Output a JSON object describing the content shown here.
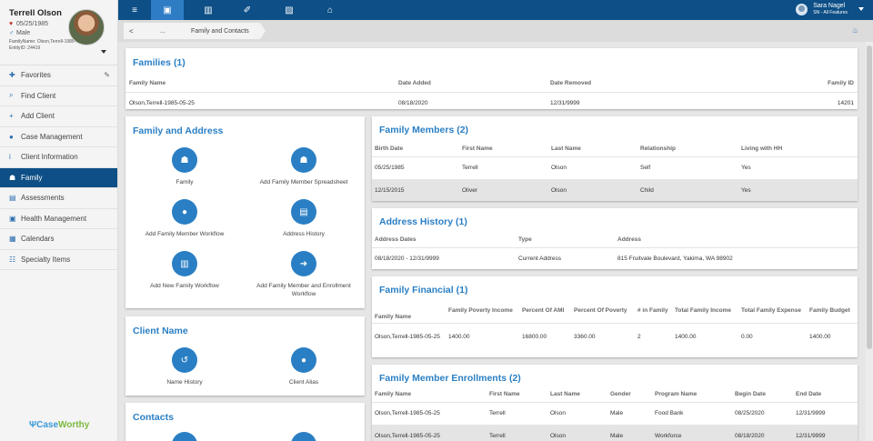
{
  "profile": {
    "name": "Terrell Olson",
    "dob": "05/25/1985",
    "gender": "Male",
    "family_name_line": "FamilyName: Olson,Terrell-1985-05-25",
    "entity_line": "EntityID: 24419"
  },
  "nav": [
    {
      "label": "Favorites",
      "icon": "pin-icon"
    },
    {
      "label": "Find Client",
      "icon": "search-icon"
    },
    {
      "label": "Add Client",
      "icon": "plus-icon"
    },
    {
      "label": "Case Management",
      "icon": "user-icon"
    },
    {
      "label": "Client Information",
      "icon": "info-icon"
    },
    {
      "label": "Family",
      "icon": "family-icon"
    },
    {
      "label": "Assessments",
      "icon": "copy-icon"
    },
    {
      "label": "Health Management",
      "icon": "medkit-icon"
    },
    {
      "label": "Calendars",
      "icon": "calendar-icon"
    },
    {
      "label": "Specialty Items",
      "icon": "users-icon"
    }
  ],
  "logo": {
    "part1": "Case",
    "part2": "Worthy"
  },
  "user": {
    "name": "Sara Nagel",
    "role": "SN - All Features"
  },
  "breadcrumbs": {
    "back": "<",
    "c1": "...",
    "c2": "Family and Contacts"
  },
  "families": {
    "title": "Families (1)",
    "headers": [
      "Family Name",
      "Date Added",
      "Date Removed",
      "Family ID"
    ],
    "rows": [
      [
        "Olson,Terrell-1985-05-25",
        "08/18/2020",
        "12/31/9999",
        "14201"
      ]
    ]
  },
  "family_address": {
    "title": "Family and Address",
    "actions": [
      {
        "label": "Family",
        "icon": "family-icon"
      },
      {
        "label": "Add Family Member Spreadsheet",
        "icon": "family-icon"
      },
      {
        "label": "Add Family Member Workflow",
        "icon": "user-icon"
      },
      {
        "label": "Address History",
        "icon": "file-icon"
      },
      {
        "label": "Add New Family Workflow",
        "icon": "bank-icon"
      },
      {
        "label": "Add Family Member and Enrollment Workflow",
        "icon": "sign-in-icon"
      }
    ]
  },
  "client_name": {
    "title": "Client Name",
    "actions": [
      {
        "label": "Name History",
        "icon": "history-icon"
      },
      {
        "label": "Client Alias",
        "icon": "circle-icon"
      }
    ]
  },
  "contacts": {
    "title": "Contacts"
  },
  "family_members": {
    "title": "Family Members (2)",
    "headers": [
      "Birth Date",
      "First Name",
      "Last Name",
      "Relationship",
      "Living with HH"
    ],
    "rows": [
      [
        "05/25/1985",
        "Terrell",
        "Olson",
        "Self",
        "Yes"
      ],
      [
        "12/15/2015",
        "Oliver",
        "Olson",
        "Child",
        "Yes"
      ]
    ]
  },
  "address_history": {
    "title": "Address History (1)",
    "headers": [
      "Address Dates",
      "Type",
      "Address"
    ],
    "rows": [
      [
        "08/18/2020 - 12/31/9999",
        "Current Address",
        "815 Fruitvale Boulevard, Yakima, WA 98902"
      ]
    ]
  },
  "family_financial": {
    "title": "Family Financial (1)",
    "headers": [
      "Family Name",
      "Family Poverty Income",
      "Percent Of AMI",
      "Percent Of Poverty",
      "# in Family",
      "Total Family Income",
      "Total Family Expense",
      "Family Budget"
    ],
    "rows": [
      [
        "Olson,Terrell-1985-05-25",
        "1400.00",
        "16800.00",
        "3360.00",
        "2",
        "1400.00",
        "0.00",
        "1400.00"
      ]
    ]
  },
  "enrollments": {
    "title": "Family Member Enrollments (2)",
    "headers": [
      "Family Name",
      "First Name",
      "Last Name",
      "Gender",
      "Program Name",
      "Begin Date",
      "End Date"
    ],
    "rows": [
      [
        "Olson,Terrell-1985-05-25",
        "Terrell",
        "Olson",
        "Male",
        "Food Bank",
        "08/25/2020",
        "12/31/9999"
      ],
      [
        "Olson,Terrell-1985-05-25",
        "Terrell",
        "Olson",
        "Male",
        "Workforce",
        "08/18/2020",
        "12/31/9999"
      ]
    ]
  },
  "colors": {
    "primary": "#0d4f86",
    "accent": "#2a7fc4"
  }
}
